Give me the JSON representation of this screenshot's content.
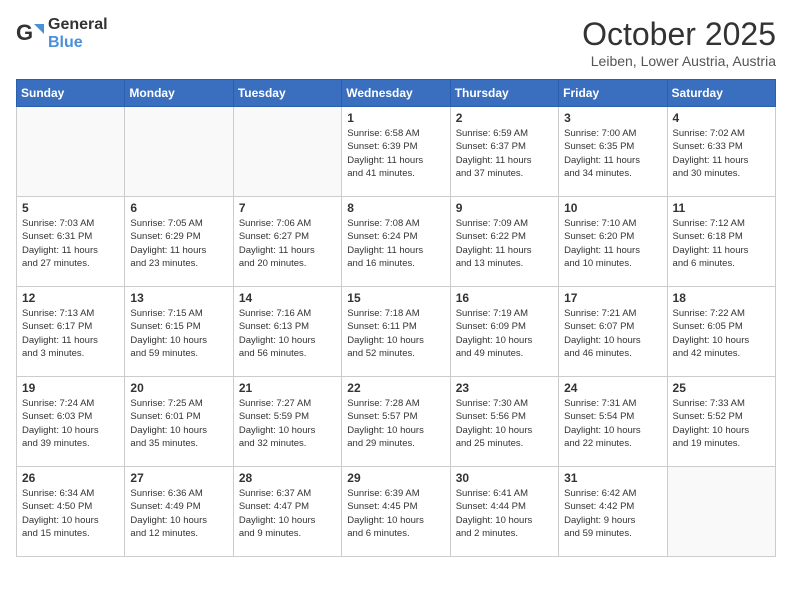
{
  "header": {
    "logo_line1": "General",
    "logo_line2": "Blue",
    "month_title": "October 2025",
    "location": "Leiben, Lower Austria, Austria"
  },
  "weekdays": [
    "Sunday",
    "Monday",
    "Tuesday",
    "Wednesday",
    "Thursday",
    "Friday",
    "Saturday"
  ],
  "weeks": [
    [
      {
        "day": "",
        "info": ""
      },
      {
        "day": "",
        "info": ""
      },
      {
        "day": "",
        "info": ""
      },
      {
        "day": "1",
        "info": "Sunrise: 6:58 AM\nSunset: 6:39 PM\nDaylight: 11 hours\nand 41 minutes."
      },
      {
        "day": "2",
        "info": "Sunrise: 6:59 AM\nSunset: 6:37 PM\nDaylight: 11 hours\nand 37 minutes."
      },
      {
        "day": "3",
        "info": "Sunrise: 7:00 AM\nSunset: 6:35 PM\nDaylight: 11 hours\nand 34 minutes."
      },
      {
        "day": "4",
        "info": "Sunrise: 7:02 AM\nSunset: 6:33 PM\nDaylight: 11 hours\nand 30 minutes."
      }
    ],
    [
      {
        "day": "5",
        "info": "Sunrise: 7:03 AM\nSunset: 6:31 PM\nDaylight: 11 hours\nand 27 minutes."
      },
      {
        "day": "6",
        "info": "Sunrise: 7:05 AM\nSunset: 6:29 PM\nDaylight: 11 hours\nand 23 minutes."
      },
      {
        "day": "7",
        "info": "Sunrise: 7:06 AM\nSunset: 6:27 PM\nDaylight: 11 hours\nand 20 minutes."
      },
      {
        "day": "8",
        "info": "Sunrise: 7:08 AM\nSunset: 6:24 PM\nDaylight: 11 hours\nand 16 minutes."
      },
      {
        "day": "9",
        "info": "Sunrise: 7:09 AM\nSunset: 6:22 PM\nDaylight: 11 hours\nand 13 minutes."
      },
      {
        "day": "10",
        "info": "Sunrise: 7:10 AM\nSunset: 6:20 PM\nDaylight: 11 hours\nand 10 minutes."
      },
      {
        "day": "11",
        "info": "Sunrise: 7:12 AM\nSunset: 6:18 PM\nDaylight: 11 hours\nand 6 minutes."
      }
    ],
    [
      {
        "day": "12",
        "info": "Sunrise: 7:13 AM\nSunset: 6:17 PM\nDaylight: 11 hours\nand 3 minutes."
      },
      {
        "day": "13",
        "info": "Sunrise: 7:15 AM\nSunset: 6:15 PM\nDaylight: 10 hours\nand 59 minutes."
      },
      {
        "day": "14",
        "info": "Sunrise: 7:16 AM\nSunset: 6:13 PM\nDaylight: 10 hours\nand 56 minutes."
      },
      {
        "day": "15",
        "info": "Sunrise: 7:18 AM\nSunset: 6:11 PM\nDaylight: 10 hours\nand 52 minutes."
      },
      {
        "day": "16",
        "info": "Sunrise: 7:19 AM\nSunset: 6:09 PM\nDaylight: 10 hours\nand 49 minutes."
      },
      {
        "day": "17",
        "info": "Sunrise: 7:21 AM\nSunset: 6:07 PM\nDaylight: 10 hours\nand 46 minutes."
      },
      {
        "day": "18",
        "info": "Sunrise: 7:22 AM\nSunset: 6:05 PM\nDaylight: 10 hours\nand 42 minutes."
      }
    ],
    [
      {
        "day": "19",
        "info": "Sunrise: 7:24 AM\nSunset: 6:03 PM\nDaylight: 10 hours\nand 39 minutes."
      },
      {
        "day": "20",
        "info": "Sunrise: 7:25 AM\nSunset: 6:01 PM\nDaylight: 10 hours\nand 35 minutes."
      },
      {
        "day": "21",
        "info": "Sunrise: 7:27 AM\nSunset: 5:59 PM\nDaylight: 10 hours\nand 32 minutes."
      },
      {
        "day": "22",
        "info": "Sunrise: 7:28 AM\nSunset: 5:57 PM\nDaylight: 10 hours\nand 29 minutes."
      },
      {
        "day": "23",
        "info": "Sunrise: 7:30 AM\nSunset: 5:56 PM\nDaylight: 10 hours\nand 25 minutes."
      },
      {
        "day": "24",
        "info": "Sunrise: 7:31 AM\nSunset: 5:54 PM\nDaylight: 10 hours\nand 22 minutes."
      },
      {
        "day": "25",
        "info": "Sunrise: 7:33 AM\nSunset: 5:52 PM\nDaylight: 10 hours\nand 19 minutes."
      }
    ],
    [
      {
        "day": "26",
        "info": "Sunrise: 6:34 AM\nSunset: 4:50 PM\nDaylight: 10 hours\nand 15 minutes."
      },
      {
        "day": "27",
        "info": "Sunrise: 6:36 AM\nSunset: 4:49 PM\nDaylight: 10 hours\nand 12 minutes."
      },
      {
        "day": "28",
        "info": "Sunrise: 6:37 AM\nSunset: 4:47 PM\nDaylight: 10 hours\nand 9 minutes."
      },
      {
        "day": "29",
        "info": "Sunrise: 6:39 AM\nSunset: 4:45 PM\nDaylight: 10 hours\nand 6 minutes."
      },
      {
        "day": "30",
        "info": "Sunrise: 6:41 AM\nSunset: 4:44 PM\nDaylight: 10 hours\nand 2 minutes."
      },
      {
        "day": "31",
        "info": "Sunrise: 6:42 AM\nSunset: 4:42 PM\nDaylight: 9 hours\nand 59 minutes."
      },
      {
        "day": "",
        "info": ""
      }
    ]
  ]
}
